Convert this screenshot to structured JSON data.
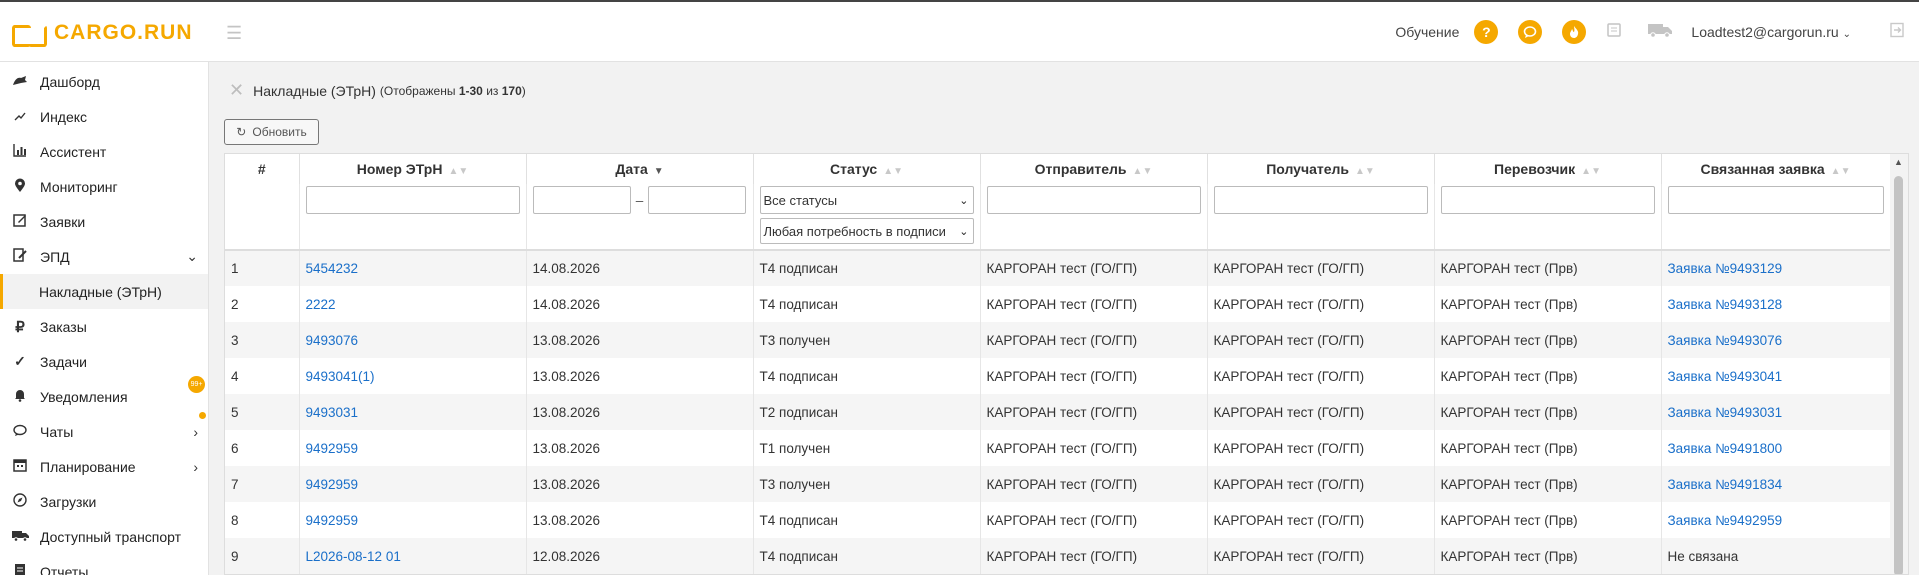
{
  "app": {
    "logo_text": "CARGO.RUN"
  },
  "header": {
    "learning_label": "Обучение",
    "help_icon": "?",
    "user_email": "Loadtest2@cargorun.ru"
  },
  "sidebar": {
    "items": [
      {
        "label": "Дашборд"
      },
      {
        "label": "Индекс"
      },
      {
        "label": "Ассистент"
      },
      {
        "label": "Мониторинг"
      },
      {
        "label": "Заявки"
      },
      {
        "label": "ЭПД"
      },
      {
        "label": "Заказы"
      },
      {
        "label": "Задачи"
      },
      {
        "label": "Уведомления",
        "badge": "99+"
      },
      {
        "label": "Чаты"
      },
      {
        "label": "Планирование"
      },
      {
        "label": "Загрузки"
      },
      {
        "label": "Доступный транспорт"
      },
      {
        "label": "Отчеты"
      }
    ],
    "subitem": "Накладные (ЭТрН)"
  },
  "page": {
    "title": "Накладные (ЭТрН)",
    "count_prefix": "(Отображены",
    "count_range": "1-30",
    "count_of": "из",
    "count_total": "170",
    "count_suffix": ")",
    "refresh_label": "Обновить"
  },
  "table": {
    "columns": [
      "#",
      "Номер ЭТрН",
      "Дата",
      "Статус",
      "Отправитель",
      "Получатель",
      "Перевозчик",
      "Связанная заявка"
    ],
    "filters": {
      "date_separator": "–",
      "status_select": "Все статусы",
      "signature_select": "Любая потребность в подписи"
    },
    "rows": [
      [
        "1",
        "5454232",
        "14.08.2026",
        "Т4 подписан",
        "КАРГОРАН тест (ГО/ГП)",
        "КАРГОРАН тест (ГО/ГП)",
        "КАРГОРАН тест (Прв)",
        "Заявка №9493129"
      ],
      [
        "2",
        "2222",
        "14.08.2026",
        "Т4 подписан",
        "КАРГОРАН тест (ГО/ГП)",
        "КАРГОРАН тест (ГО/ГП)",
        "КАРГОРАН тест (Прв)",
        "Заявка №9493128"
      ],
      [
        "3",
        "9493076",
        "13.08.2026",
        "Т3 получен",
        "КАРГОРАН тест (ГО/ГП)",
        "КАРГОРАН тест (ГО/ГП)",
        "КАРГОРАН тест (Прв)",
        "Заявка №9493076"
      ],
      [
        "4",
        "9493041(1)",
        "13.08.2026",
        "Т4 подписан",
        "КАРГОРАН тест (ГО/ГП)",
        "КАРГОРАН тест (ГО/ГП)",
        "КАРГОРАН тест (Прв)",
        "Заявка №9493041"
      ],
      [
        "5",
        "9493031",
        "13.08.2026",
        "Т2 подписан",
        "КАРГОРАН тест (ГО/ГП)",
        "КАРГОРАН тест (ГО/ГП)",
        "КАРГОРАН тест (Прв)",
        "Заявка №9493031"
      ],
      [
        "6",
        "9492959",
        "13.08.2026",
        "Т1 получен",
        "КАРГОРАН тест (ГО/ГП)",
        "КАРГОРАН тест (ГО/ГП)",
        "КАРГОРАН тест (Прв)",
        "Заявка №9491800"
      ],
      [
        "7",
        "9492959",
        "13.08.2026",
        "Т3 получен",
        "КАРГОРАН тест (ГО/ГП)",
        "КАРГОРАН тест (ГО/ГП)",
        "КАРГОРАН тест (Прв)",
        "Заявка №9491834"
      ],
      [
        "8",
        "9492959",
        "13.08.2026",
        "Т4 подписан",
        "КАРГОРАН тест (ГО/ГП)",
        "КАРГОРАН тест (ГО/ГП)",
        "КАРГОРАН тест (Прв)",
        "Заявка №9492959"
      ],
      [
        "9",
        "L2026-08-12 01",
        "12.08.2026",
        "Т4 подписан",
        "КАРГОРАН тест (ГО/ГП)",
        "КАРГОРАН тест (ГО/ГП)",
        "КАРГОРАН тест (Прв)",
        "Не связана"
      ]
    ]
  },
  "colors": {
    "accent": "#f5a800",
    "link": "#1a6fc9"
  },
  "icons": [
    "hamburger-icon",
    "help-icon",
    "chat-icon",
    "fire-icon",
    "book-icon",
    "truck-icon",
    "logout-icon",
    "close-icon",
    "refresh-icon",
    "sort-icon"
  ]
}
